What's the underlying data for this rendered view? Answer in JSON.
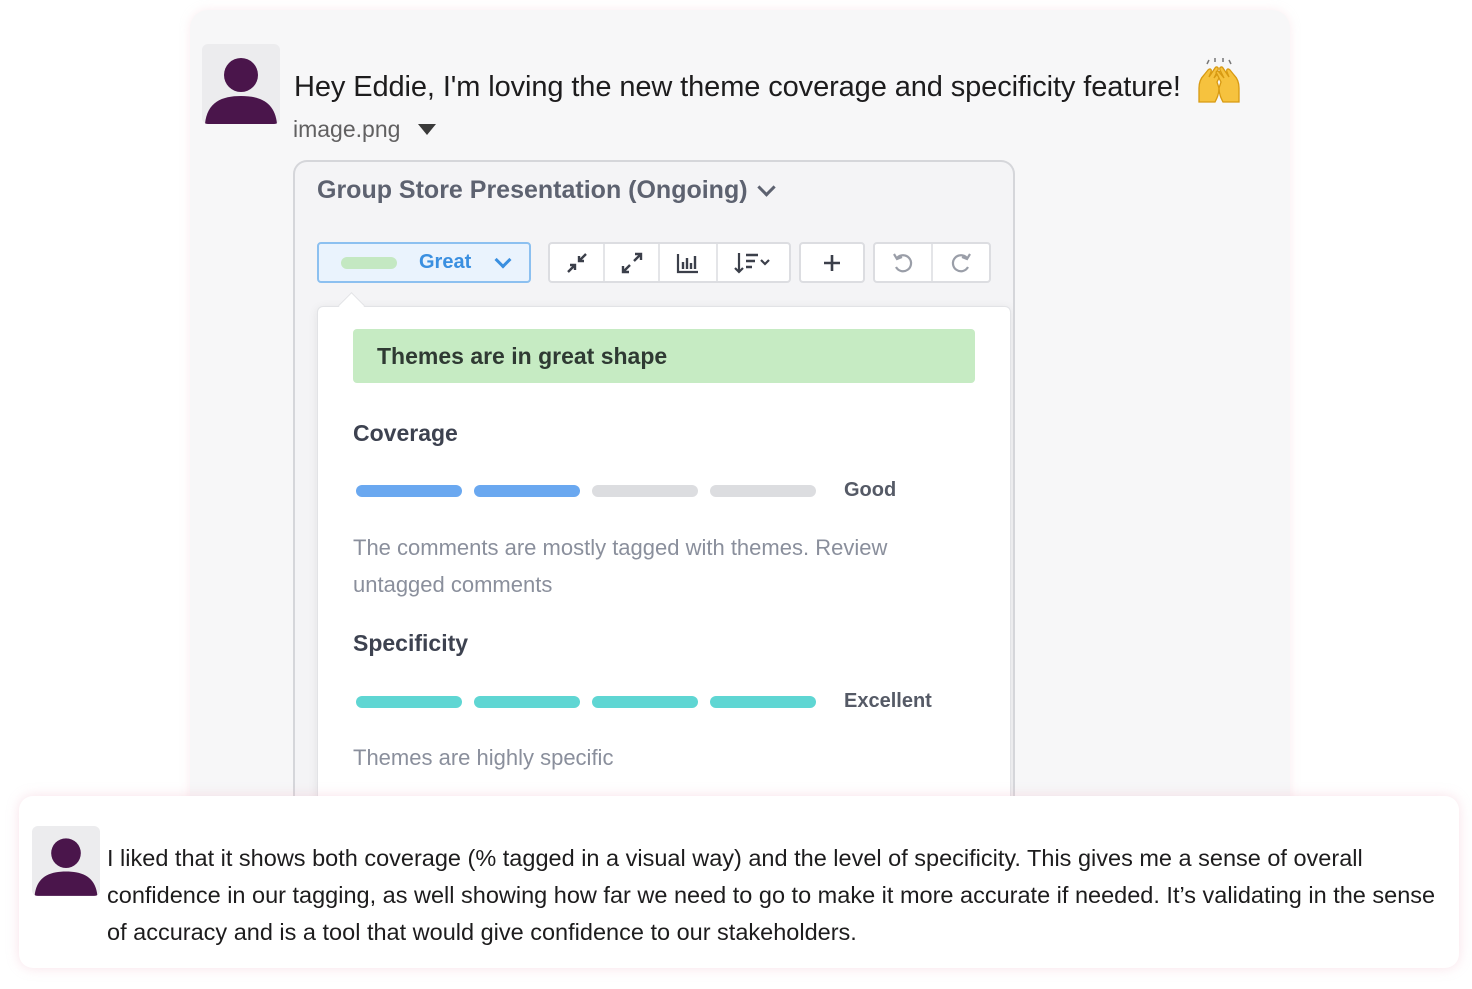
{
  "message": {
    "text": "Hey Eddie, I'm loving the new theme coverage and specificity feature!",
    "emoji": "raised-hands-emoji",
    "attachment_name": "image.png"
  },
  "screenshot": {
    "title": "Group Store Presentation (Ongoing)",
    "status_label": "Great",
    "toolbar_icons": [
      "collapse-icon",
      "expand-icon",
      "chart-icon",
      "sort-icon",
      "plus-icon",
      "undo-icon",
      "redo-icon"
    ],
    "banner": "Themes are in great shape",
    "coverage": {
      "title": "Coverage",
      "level": 2,
      "max": 4,
      "label": "Good",
      "description": "The comments are mostly tagged with themes. Review untagged comments"
    },
    "specificity": {
      "title": "Specificity",
      "level": 4,
      "max": 4,
      "label": "Excellent",
      "description": "Themes are highly specific"
    }
  },
  "quote": {
    "text": "I liked that it shows both coverage (% tagged in a visual way) and the level of specificity. This gives me a sense of overall confidence in our tagging, as well showing how far we need to go to make it more accurate if needed. It’s validating in the sense of accuracy and is a tool that would give confidence to our stakeholders."
  },
  "colors": {
    "avatar": "#4a154b",
    "coverage_on": "#6aa8f0",
    "specificity_on": "#5fd6d3",
    "segment_off": "#dcdde0",
    "banner": "#c6ebc3",
    "status_accent": "#3a8fe0"
  }
}
